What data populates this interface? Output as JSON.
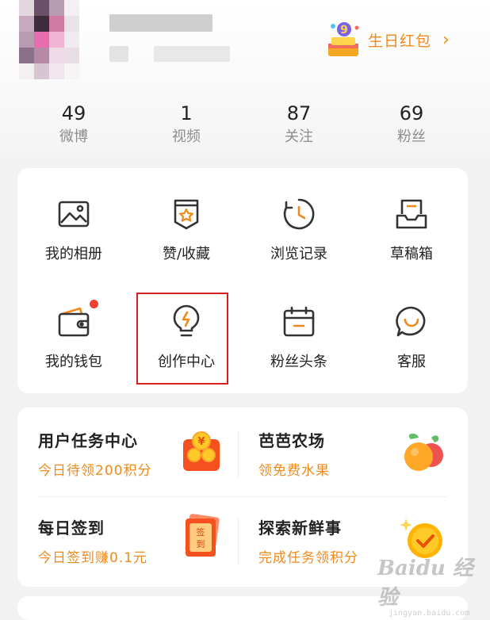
{
  "profile": {
    "birthday_label": "生日红包"
  },
  "stats": [
    {
      "value": "49",
      "label": "微博"
    },
    {
      "value": "1",
      "label": "视频"
    },
    {
      "value": "87",
      "label": "关注"
    },
    {
      "value": "69",
      "label": "粉丝"
    }
  ],
  "grid": [
    {
      "label": "我的相册",
      "icon": "photo-album-icon"
    },
    {
      "label": "赞/收藏",
      "icon": "like-favorite-icon"
    },
    {
      "label": "浏览记录",
      "icon": "history-icon"
    },
    {
      "label": "草稿箱",
      "icon": "drafts-icon"
    },
    {
      "label": "我的钱包",
      "icon": "wallet-icon"
    },
    {
      "label": "创作中心",
      "icon": "lightbulb-icon"
    },
    {
      "label": "粉丝头条",
      "icon": "calendar-icon"
    },
    {
      "label": "客服",
      "icon": "chat-bubble-icon"
    }
  ],
  "promos": [
    {
      "title": "用户任务中心",
      "subtitle": "今日待领200积分",
      "icon": "coins-icon"
    },
    {
      "title": "芭芭农场",
      "subtitle": "领免费水果",
      "icon": "fruit-icon"
    },
    {
      "title": "每日签到",
      "subtitle": "今日签到赚0.1元",
      "icon": "sign-in-card-icon",
      "icon_text": "签到"
    },
    {
      "title": "探索新鲜事",
      "subtitle": "完成任务领积分",
      "icon": "gold-check-coin-icon"
    }
  ],
  "colors": {
    "accent": "#f08a1c",
    "highlight_border": "#d81e1e",
    "badge": "#f0402f"
  },
  "watermark": {
    "brand": "Baidu 经验",
    "url": "jingyan.baidu.com"
  }
}
